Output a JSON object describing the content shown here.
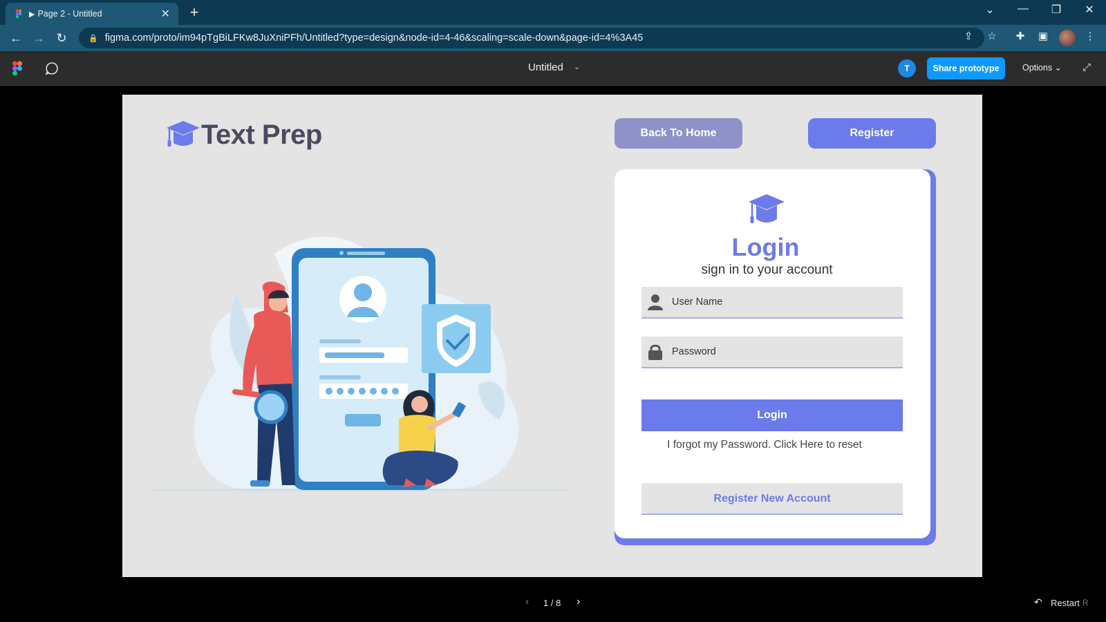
{
  "browser": {
    "tab_title": "Page 2 - Untitled",
    "tab_play": "▶",
    "tab_close": "✕",
    "new_tab": "+",
    "url": "figma.com/proto/im94pTgBiLFKw8JuXniPFh/Untitled?type=design&node-id=4-46&scaling=scale-down&page-id=4%3A45",
    "window": {
      "minimize": "—",
      "restore": "❐",
      "close": "✕",
      "tab_list": "⌄"
    }
  },
  "figma": {
    "file_title": "Untitled",
    "avatar_initial": "T",
    "share_label": "Share prototype",
    "options_label": "Options ⌄",
    "colors": {
      "toolbar_bg": "#2c2c2c",
      "share_bg": "#0d99ff"
    }
  },
  "frame": {
    "brand_name": "Text Prep",
    "back_home_label": "Back To Home",
    "register_label": "Register",
    "card": {
      "title": "Login",
      "subtitle": "sign in to your account",
      "username_placeholder": "User Name",
      "password_placeholder": "Password",
      "login_label": "Login",
      "forgot_text": "I forgot my Password. Click Here to reset",
      "new_account_label": "Register New Account"
    },
    "colors": {
      "accent": "#6c7bea",
      "secondary": "#8e92c8",
      "frame_bg": "#e4e4e4"
    }
  },
  "footer": {
    "page_indicator": "1 / 8",
    "restart_label": "Restart",
    "restart_key": "R"
  }
}
